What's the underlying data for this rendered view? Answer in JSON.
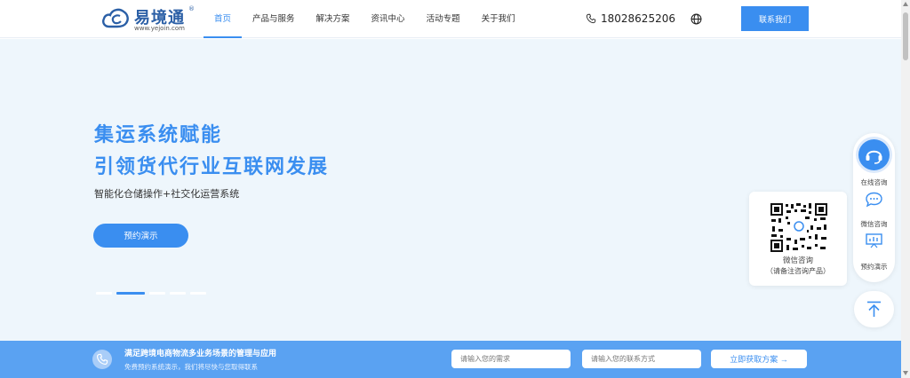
{
  "header": {
    "logo": {
      "name": "易境通",
      "reg": "®",
      "url": "www.yejoin.com"
    },
    "nav": [
      {
        "label": "首页",
        "active": true
      },
      {
        "label": "产品与服务",
        "active": false
      },
      {
        "label": "解决方案",
        "active": false
      },
      {
        "label": "资讯中心",
        "active": false
      },
      {
        "label": "活动专题",
        "active": false
      },
      {
        "label": "关于我们",
        "active": false
      }
    ],
    "phone": "18028625206",
    "phone_icon": "phone-icon",
    "globe_icon": "globe-icon",
    "contact_button": "联系我们"
  },
  "hero": {
    "title_line1": "集运系统赋能",
    "title_line2": "引领货代行业互联网发展",
    "subtitle": "智能化仓储操作+社交化运营系统",
    "cta": "预约演示",
    "carousel": {
      "count": 5,
      "active": 1
    }
  },
  "qr_popup": {
    "title": "微信咨询",
    "note": "（请备注咨询产品）"
  },
  "side_panel": {
    "items": [
      {
        "label": "在线咨询",
        "icon": "headset-icon"
      },
      {
        "label": "微信咨询",
        "icon": "chat-icon"
      },
      {
        "label": "预约演示",
        "icon": "presentation-icon"
      }
    ],
    "back_to_top_icon": "arrow-up-icon"
  },
  "bottom_bar": {
    "title": "满足跨境电商物流多业务场景的管理与应用",
    "subtitle": "免费预约系统演示，我们将尽快与您取得联系",
    "demand_placeholder": "请输入您的需求",
    "contact_placeholder": "请输入您的联系方式",
    "submit": "立即获取方案 →"
  },
  "colors": {
    "accent": "#3a8ef0",
    "hero_bg": "#eef6fc",
    "bottom_bg": "#5aa2f2"
  }
}
